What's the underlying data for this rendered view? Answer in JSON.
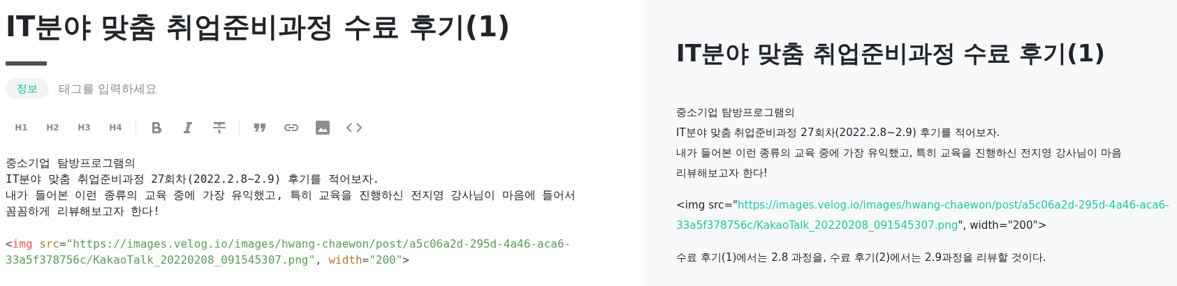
{
  "editor": {
    "title": "IT분야 맞춤 취업준비과정 수료 후기(1)",
    "tags": [
      {
        "label": "정보"
      }
    ],
    "tag_input": {
      "placeholder": "태그를 입력하세요"
    },
    "toolbar": [
      {
        "kind": "text",
        "label": "H1"
      },
      {
        "kind": "text",
        "label": "H2"
      },
      {
        "kind": "text",
        "label": "H3"
      },
      {
        "kind": "text",
        "label": "H4"
      },
      {
        "kind": "divider"
      },
      {
        "kind": "bold"
      },
      {
        "kind": "italic"
      },
      {
        "kind": "strike"
      },
      {
        "kind": "divider"
      },
      {
        "kind": "quote"
      },
      {
        "kind": "link"
      },
      {
        "kind": "image"
      },
      {
        "kind": "code"
      }
    ],
    "paragraphs": [
      [
        [
          {
            "kind": "text",
            "text": "중소기업 탐방프로그램의"
          }
        ],
        [
          {
            "kind": "text",
            "text": "IT분야 맞춤 취업준비과정 27회차(2022.2.8~2.9) 후기를 적어보자."
          }
        ],
        [
          {
            "kind": "text",
            "text": "내가 들어본 이런 종류의 교육 중에 가장 유익했고, 특히 교육을 진행하신 전지영 강사님이 마음에 들어서"
          }
        ],
        [
          {
            "kind": "text",
            "text": "꼼꼼하게 리뷰해보고자 한다!"
          }
        ]
      ],
      [
        [
          {
            "kind": "punct",
            "text": "<"
          },
          {
            "kind": "tag",
            "text": "img"
          },
          {
            "kind": "attr",
            "text": " src"
          },
          {
            "kind": "punct",
            "text": "="
          },
          {
            "kind": "string",
            "text": "\"https://images.velog.io/images/hwang-chaewon/post/a5c06a2d-295d-4a46-aca6-"
          }
        ],
        [
          {
            "kind": "string",
            "text": "33a5f378756c/KakaoTalk_20220208_091545307.png\""
          },
          {
            "kind": "punct",
            "text": ", "
          },
          {
            "kind": "attr",
            "text": "width"
          },
          {
            "kind": "punct",
            "text": "="
          },
          {
            "kind": "string",
            "text": "\"200\""
          },
          {
            "kind": "punct",
            "text": ">"
          }
        ]
      ]
    ]
  },
  "preview": {
    "title": "IT분야 맞춤 취업준비과정 수료 후기(1)",
    "paragraphs": [
      [
        [
          {
            "kind": "text",
            "text": "중소기업 탐방프로그램의"
          }
        ],
        [
          {
            "kind": "text",
            "text": "IT분야 맞춤 취업준비과정 27회차(2022.2.8~2.9) 후기를 적어보자."
          }
        ],
        [
          {
            "kind": "text",
            "text": "내가 들어본 이런 종류의 교육 중에 가장 유익했고, 특히 교육을 진행하신 전지영 강사님이 마음"
          }
        ],
        [
          {
            "kind": "text",
            "text": "리뷰해보고자 한다!"
          }
        ]
      ],
      [
        [
          {
            "kind": "text",
            "text": "<img src=\""
          },
          {
            "kind": "link",
            "text": "https://images.velog.io/images/hwang-chaewon/post/a5c06a2d-295d-4a46-aca6-"
          }
        ],
        [
          {
            "kind": "link",
            "text": "33a5f378756c/KakaoTalk_20220208_091545307.png"
          },
          {
            "kind": "text",
            "text": "\", width=\"200\">"
          }
        ]
      ],
      [
        [
          {
            "kind": "text",
            "text": "수료 후기(1)에서는 2.8 과정을, 수료 후기(2)에서는 2.9과정을 리뷰할 것이다."
          }
        ]
      ]
    ]
  }
}
